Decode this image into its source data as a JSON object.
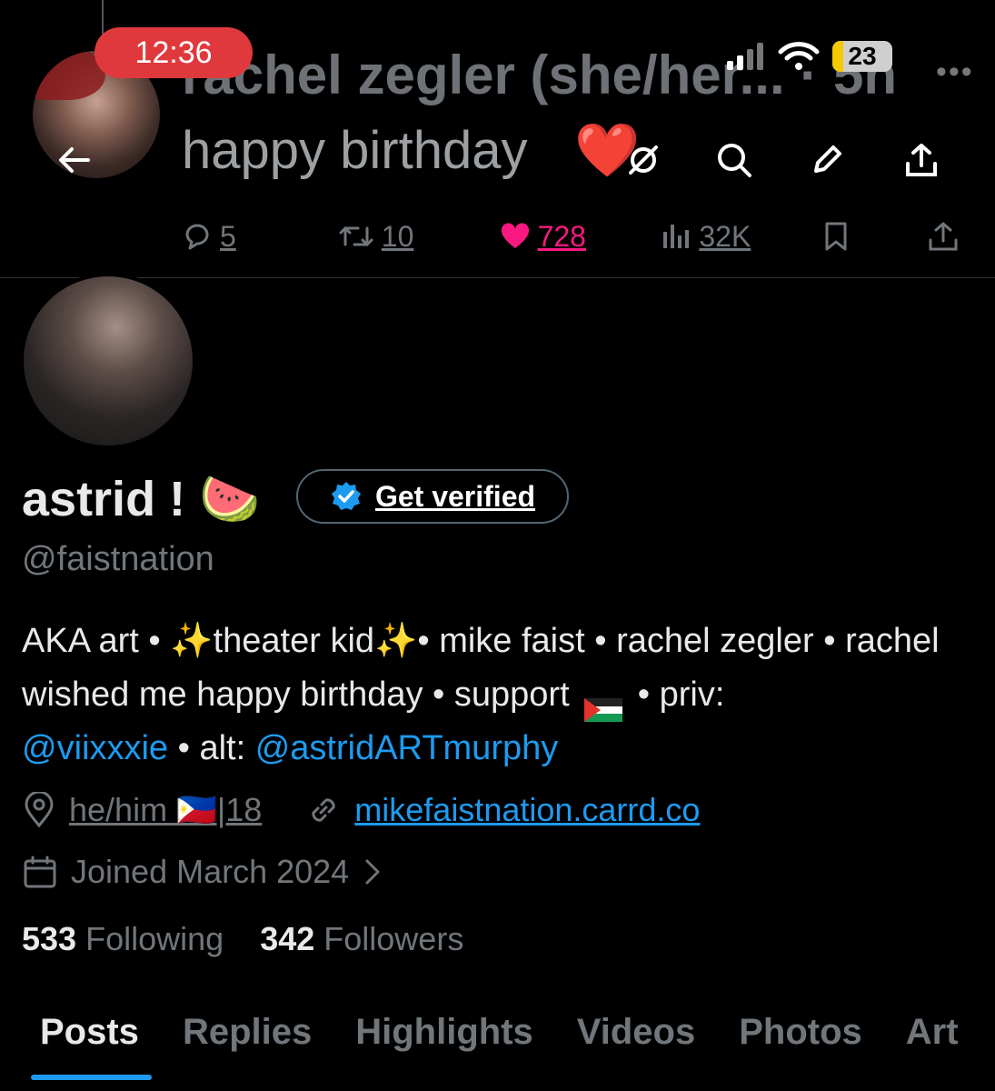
{
  "status_bar": {
    "time": "12:36",
    "battery": "23"
  },
  "tweet": {
    "author": "rachel zegler (she/her... · 5h",
    "text": "happy birthday",
    "heart_emoji": "❤️",
    "stats": {
      "replies": "5",
      "reposts": "10",
      "likes": "728",
      "views": "32K"
    }
  },
  "profile": {
    "display_name": "astrid ! 🍉",
    "get_verified": "Get verified",
    "handle": "@faistnation",
    "bio_part1": "AKA art • ✨theater kid✨• mike faist • rachel zegler • rachel wished me happy birthday • support",
    "bio_part2": " • priv: ",
    "bio_mention1": "@viixxxie",
    "bio_part3": " • alt: ",
    "bio_mention2": "@astridARTmurphy",
    "location": "he/him 🇵🇭|18",
    "website": "mikefaistnation.carrd.co",
    "joined": "Joined March 2024",
    "following_count": "533",
    "following_label": "Following",
    "followers_count": "342",
    "followers_label": "Followers"
  },
  "tabs": [
    "Posts",
    "Replies",
    "Highlights",
    "Videos",
    "Photos",
    "Art"
  ],
  "colors": {
    "accent": "#1d9bf0",
    "like": "#f91880",
    "time_pill": "#e0393d"
  },
  "icons": [
    "back-arrow-icon",
    "grok-icon",
    "search-icon",
    "edit-icon",
    "share-icon",
    "reply-icon",
    "repost-icon",
    "heart-icon",
    "views-icon",
    "bookmark-icon",
    "location-icon",
    "link-icon",
    "calendar-icon",
    "chevron-right-icon",
    "verified-badge-icon"
  ]
}
